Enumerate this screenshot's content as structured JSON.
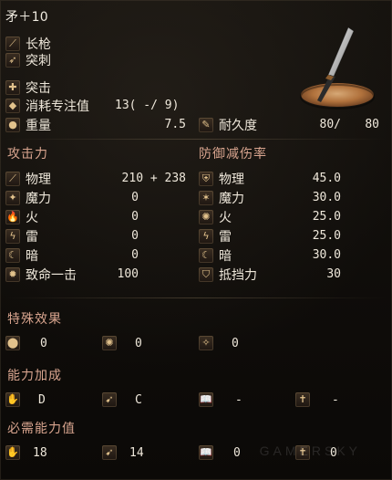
{
  "header": {
    "title": "矛＋10"
  },
  "weapon_info": {
    "weapon_type": "长枪",
    "attack_type": "突刺",
    "skill": "突击",
    "fp_cost_label": "消耗专注值",
    "fp_cost_value": "13( -/ 9)",
    "weight_label": "重量",
    "weight_value": "7.5",
    "durability_label": "耐久度",
    "durability_current": "80/",
    "durability_max": "80"
  },
  "attack": {
    "title": "攻击力",
    "rows": [
      {
        "name": "物理",
        "value": "210 +  238",
        "icon": "sword-icon"
      },
      {
        "name": "魔力",
        "value": "0",
        "icon": "magic-icon"
      },
      {
        "name": "火",
        "value": "0",
        "icon": "fire-icon"
      },
      {
        "name": "雷",
        "value": "0",
        "icon": "lightning-icon"
      },
      {
        "name": "暗",
        "value": "0",
        "icon": "dark-icon"
      },
      {
        "name": "致命一击",
        "value": "100",
        "icon": "critical-icon"
      }
    ]
  },
  "defense": {
    "title": "防御减伤率",
    "rows": [
      {
        "name": "物理",
        "value": "45.0",
        "icon": "shield-icon"
      },
      {
        "name": "魔力",
        "value": "30.0",
        "icon": "magic-shield-icon"
      },
      {
        "name": "火",
        "value": "25.0",
        "icon": "fire-shield-icon"
      },
      {
        "name": "雷",
        "value": "25.0",
        "icon": "lightning-shield-icon"
      },
      {
        "name": "暗",
        "value": "30.0",
        "icon": "dark-shield-icon"
      },
      {
        "name": "抵挡力",
        "value": "30",
        "icon": "stability-icon"
      }
    ]
  },
  "special_effects": {
    "title": "特殊效果",
    "items": [
      {
        "icon": "bleed-icon",
        "value": "0"
      },
      {
        "icon": "poison-icon",
        "value": "0"
      },
      {
        "icon": "frost-icon",
        "value": "0"
      }
    ]
  },
  "attribute_bonus": {
    "title": "能力加成",
    "items": [
      {
        "icon": "strength-icon",
        "value": "D"
      },
      {
        "icon": "dexterity-icon",
        "value": "C"
      },
      {
        "icon": "intelligence-icon",
        "value": "-"
      },
      {
        "icon": "faith-icon",
        "value": "-"
      }
    ]
  },
  "requirements": {
    "title": "必需能力值",
    "items": [
      {
        "icon": "strength-req-icon",
        "value": "18"
      },
      {
        "icon": "dexterity-req-icon",
        "value": "14"
      },
      {
        "icon": "intelligence-req-icon",
        "value": "0"
      },
      {
        "icon": "faith-req-icon",
        "value": "0"
      }
    ]
  },
  "watermark": {
    "text": "GAMERSKY"
  }
}
